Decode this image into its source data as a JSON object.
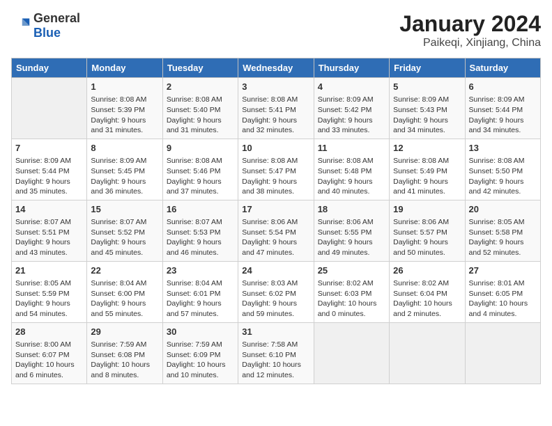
{
  "logo": {
    "general": "General",
    "blue": "Blue"
  },
  "title": "January 2024",
  "subtitle": "Paikeqi, Xinjiang, China",
  "days_of_week": [
    "Sunday",
    "Monday",
    "Tuesday",
    "Wednesday",
    "Thursday",
    "Friday",
    "Saturday"
  ],
  "weeks": [
    [
      {
        "day": "",
        "sunrise": "",
        "sunset": "",
        "daylight": ""
      },
      {
        "day": "1",
        "sunrise": "Sunrise: 8:08 AM",
        "sunset": "Sunset: 5:39 PM",
        "daylight": "Daylight: 9 hours and 31 minutes."
      },
      {
        "day": "2",
        "sunrise": "Sunrise: 8:08 AM",
        "sunset": "Sunset: 5:40 PM",
        "daylight": "Daylight: 9 hours and 31 minutes."
      },
      {
        "day": "3",
        "sunrise": "Sunrise: 8:08 AM",
        "sunset": "Sunset: 5:41 PM",
        "daylight": "Daylight: 9 hours and 32 minutes."
      },
      {
        "day": "4",
        "sunrise": "Sunrise: 8:09 AM",
        "sunset": "Sunset: 5:42 PM",
        "daylight": "Daylight: 9 hours and 33 minutes."
      },
      {
        "day": "5",
        "sunrise": "Sunrise: 8:09 AM",
        "sunset": "Sunset: 5:43 PM",
        "daylight": "Daylight: 9 hours and 34 minutes."
      },
      {
        "day": "6",
        "sunrise": "Sunrise: 8:09 AM",
        "sunset": "Sunset: 5:44 PM",
        "daylight": "Daylight: 9 hours and 34 minutes."
      }
    ],
    [
      {
        "day": "7",
        "sunrise": "Sunrise: 8:09 AM",
        "sunset": "Sunset: 5:44 PM",
        "daylight": "Daylight: 9 hours and 35 minutes."
      },
      {
        "day": "8",
        "sunrise": "Sunrise: 8:09 AM",
        "sunset": "Sunset: 5:45 PM",
        "daylight": "Daylight: 9 hours and 36 minutes."
      },
      {
        "day": "9",
        "sunrise": "Sunrise: 8:08 AM",
        "sunset": "Sunset: 5:46 PM",
        "daylight": "Daylight: 9 hours and 37 minutes."
      },
      {
        "day": "10",
        "sunrise": "Sunrise: 8:08 AM",
        "sunset": "Sunset: 5:47 PM",
        "daylight": "Daylight: 9 hours and 38 minutes."
      },
      {
        "day": "11",
        "sunrise": "Sunrise: 8:08 AM",
        "sunset": "Sunset: 5:48 PM",
        "daylight": "Daylight: 9 hours and 40 minutes."
      },
      {
        "day": "12",
        "sunrise": "Sunrise: 8:08 AM",
        "sunset": "Sunset: 5:49 PM",
        "daylight": "Daylight: 9 hours and 41 minutes."
      },
      {
        "day": "13",
        "sunrise": "Sunrise: 8:08 AM",
        "sunset": "Sunset: 5:50 PM",
        "daylight": "Daylight: 9 hours and 42 minutes."
      }
    ],
    [
      {
        "day": "14",
        "sunrise": "Sunrise: 8:07 AM",
        "sunset": "Sunset: 5:51 PM",
        "daylight": "Daylight: 9 hours and 43 minutes."
      },
      {
        "day": "15",
        "sunrise": "Sunrise: 8:07 AM",
        "sunset": "Sunset: 5:52 PM",
        "daylight": "Daylight: 9 hours and 45 minutes."
      },
      {
        "day": "16",
        "sunrise": "Sunrise: 8:07 AM",
        "sunset": "Sunset: 5:53 PM",
        "daylight": "Daylight: 9 hours and 46 minutes."
      },
      {
        "day": "17",
        "sunrise": "Sunrise: 8:06 AM",
        "sunset": "Sunset: 5:54 PM",
        "daylight": "Daylight: 9 hours and 47 minutes."
      },
      {
        "day": "18",
        "sunrise": "Sunrise: 8:06 AM",
        "sunset": "Sunset: 5:55 PM",
        "daylight": "Daylight: 9 hours and 49 minutes."
      },
      {
        "day": "19",
        "sunrise": "Sunrise: 8:06 AM",
        "sunset": "Sunset: 5:57 PM",
        "daylight": "Daylight: 9 hours and 50 minutes."
      },
      {
        "day": "20",
        "sunrise": "Sunrise: 8:05 AM",
        "sunset": "Sunset: 5:58 PM",
        "daylight": "Daylight: 9 hours and 52 minutes."
      }
    ],
    [
      {
        "day": "21",
        "sunrise": "Sunrise: 8:05 AM",
        "sunset": "Sunset: 5:59 PM",
        "daylight": "Daylight: 9 hours and 54 minutes."
      },
      {
        "day": "22",
        "sunrise": "Sunrise: 8:04 AM",
        "sunset": "Sunset: 6:00 PM",
        "daylight": "Daylight: 9 hours and 55 minutes."
      },
      {
        "day": "23",
        "sunrise": "Sunrise: 8:04 AM",
        "sunset": "Sunset: 6:01 PM",
        "daylight": "Daylight: 9 hours and 57 minutes."
      },
      {
        "day": "24",
        "sunrise": "Sunrise: 8:03 AM",
        "sunset": "Sunset: 6:02 PM",
        "daylight": "Daylight: 9 hours and 59 minutes."
      },
      {
        "day": "25",
        "sunrise": "Sunrise: 8:02 AM",
        "sunset": "Sunset: 6:03 PM",
        "daylight": "Daylight: 10 hours and 0 minutes."
      },
      {
        "day": "26",
        "sunrise": "Sunrise: 8:02 AM",
        "sunset": "Sunset: 6:04 PM",
        "daylight": "Daylight: 10 hours and 2 minutes."
      },
      {
        "day": "27",
        "sunrise": "Sunrise: 8:01 AM",
        "sunset": "Sunset: 6:05 PM",
        "daylight": "Daylight: 10 hours and 4 minutes."
      }
    ],
    [
      {
        "day": "28",
        "sunrise": "Sunrise: 8:00 AM",
        "sunset": "Sunset: 6:07 PM",
        "daylight": "Daylight: 10 hours and 6 minutes."
      },
      {
        "day": "29",
        "sunrise": "Sunrise: 7:59 AM",
        "sunset": "Sunset: 6:08 PM",
        "daylight": "Daylight: 10 hours and 8 minutes."
      },
      {
        "day": "30",
        "sunrise": "Sunrise: 7:59 AM",
        "sunset": "Sunset: 6:09 PM",
        "daylight": "Daylight: 10 hours and 10 minutes."
      },
      {
        "day": "31",
        "sunrise": "Sunrise: 7:58 AM",
        "sunset": "Sunset: 6:10 PM",
        "daylight": "Daylight: 10 hours and 12 minutes."
      },
      {
        "day": "",
        "sunrise": "",
        "sunset": "",
        "daylight": ""
      },
      {
        "day": "",
        "sunrise": "",
        "sunset": "",
        "daylight": ""
      },
      {
        "day": "",
        "sunrise": "",
        "sunset": "",
        "daylight": ""
      }
    ]
  ]
}
